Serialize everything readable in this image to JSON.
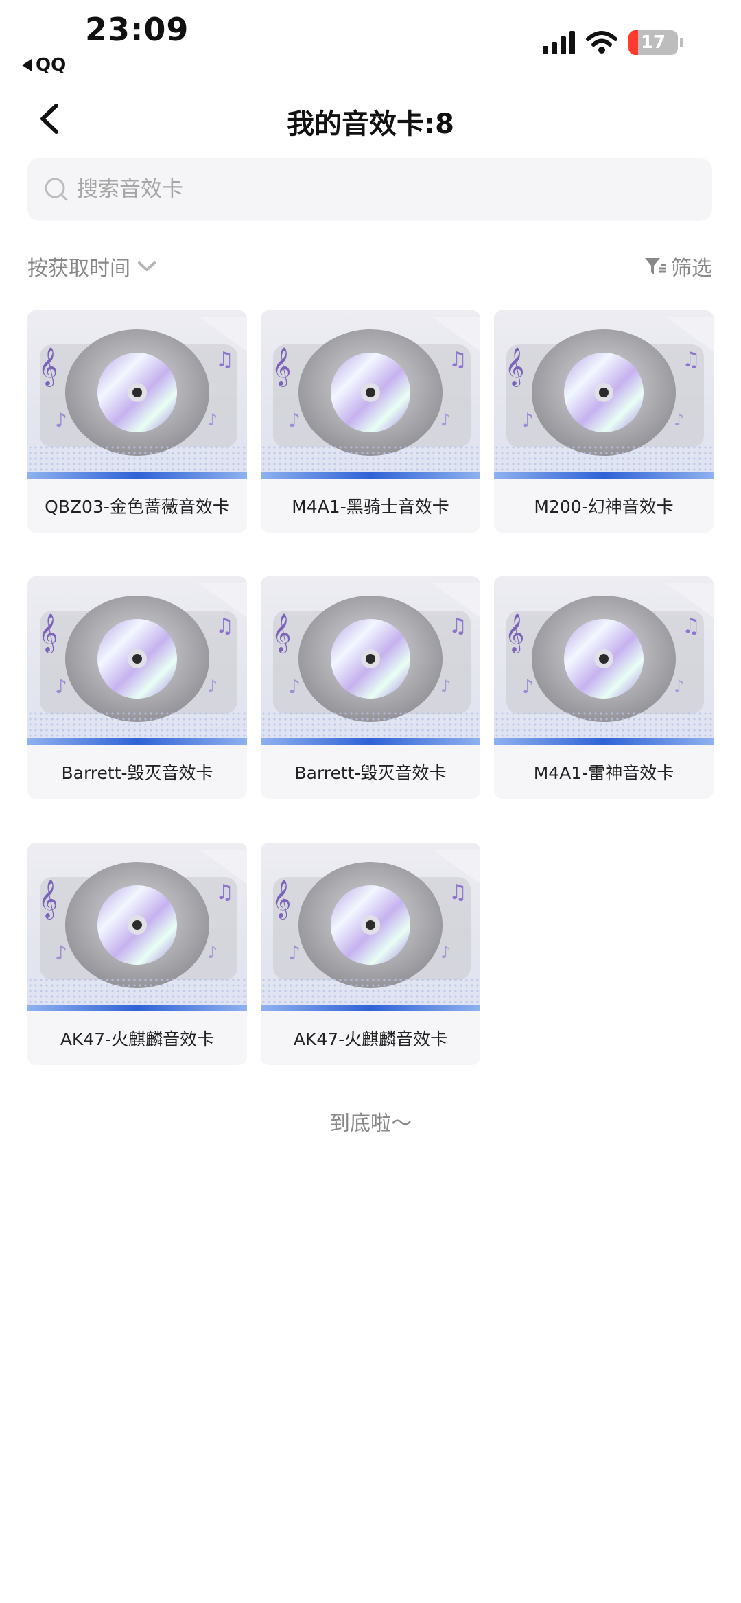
{
  "status": {
    "time": "23:09",
    "back_app": "QQ",
    "battery": "17"
  },
  "nav": {
    "title": "我的音效卡:8"
  },
  "search": {
    "placeholder": "搜索音效卡"
  },
  "toolbar": {
    "sort_label": "按获取时间",
    "filter_label": "筛选"
  },
  "cards": [
    {
      "name": "QBZ03-金色蔷薇音效卡"
    },
    {
      "name": "M4A1-黑骑士音效卡"
    },
    {
      "name": "M200-幻神音效卡"
    },
    {
      "name": "Barrett-毁灭音效卡"
    },
    {
      "name": "Barrett-毁灭音效卡"
    },
    {
      "name": "M4A1-雷神音效卡"
    },
    {
      "name": "AK47-火麒麟音效卡"
    },
    {
      "name": "AK47-火麒麟音效卡"
    }
  ],
  "footer": {
    "end_text": "到底啦～"
  },
  "colors": {
    "accent": "#2f62d6",
    "muted_text": "#888888",
    "search_bg": "#f5f5f7"
  },
  "icons": {
    "back": "chevron-left-icon",
    "search": "search-icon",
    "sort": "chevron-down-icon",
    "filter": "filter-icon",
    "card_art": "disc-icon"
  }
}
